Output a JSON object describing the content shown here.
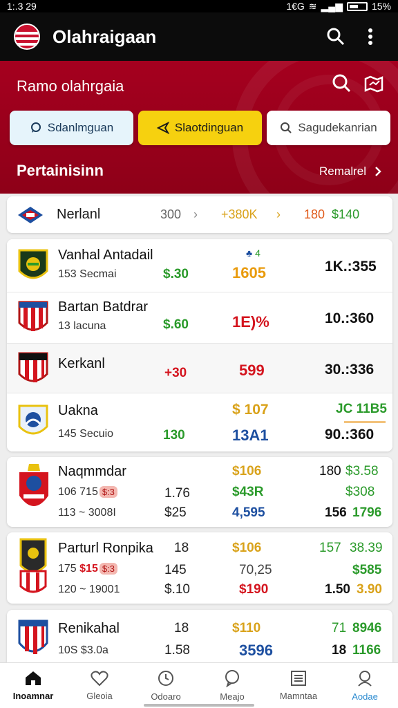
{
  "status": {
    "time": "1:.3 29",
    "right_text": "1€G",
    "battery": "15%"
  },
  "app": {
    "title": "Olahraigaan"
  },
  "hero": {
    "subtitle": "Ramo olahrgaia",
    "filters": [
      {
        "label": "Sdanlmguan",
        "icon": "chat-icon"
      },
      {
        "label": "Slaotdinguan",
        "icon": "send-icon"
      },
      {
        "label": "Sagudekanrian",
        "icon": "search-icon"
      }
    ],
    "section_title": "Pertainisinn",
    "section_more": "Remalrel"
  },
  "summary": {
    "name": "Nerlanl",
    "count": "300",
    "mid": "+380K",
    "right1": "180",
    "right2": "$140"
  },
  "rows": [
    {
      "name": "Vanhal Antadail",
      "sub": "153 Secmai",
      "a": "$.30",
      "b": "1605",
      "b_extra": "4",
      "c": "1K.:355"
    },
    {
      "name": "Bartan Batdrar",
      "sub": "13 lacuna",
      "a": "$.60",
      "b": "1E)%",
      "c": "10.:360"
    },
    {
      "name": "Kerkanl",
      "sub": "",
      "a": "+30",
      "b": "599",
      "c": "30.:336"
    },
    {
      "name": "Uakna",
      "sub": "145 Secuio",
      "a": "130",
      "top_b": "$ 107",
      "top_c": "JC 11B5",
      "b": "13A1",
      "c": "90.:360"
    }
  ],
  "details": [
    {
      "name": "Naqmmdar",
      "l1_a": "106 715",
      "l1_pill": "$:3",
      "l1_b": "1.76",
      "l1_c": "$106",
      "l1_d": "180",
      "l1_e": "$3.58",
      "l2_c": "$43R",
      "l2_e": "$308",
      "l3_a": "113 ~ 3008I",
      "l3_b": "$25",
      "l3_c": "4,595",
      "l3_d": "156",
      "l3_e": "1796"
    },
    {
      "name": "Parturl Ronpika",
      "name_extra": "18",
      "l1_a": "175",
      "l1_red": "$15",
      "l1_pill": "$:3",
      "l1_b": "145",
      "l1_c": "$106",
      "l1_d": "157",
      "l1_e": "38.39",
      "l2_c": "70,25",
      "l2_e": "$585",
      "l3_a": "120 ~ 19001",
      "l3_b": "$.10",
      "l3_c": "$190",
      "l3_d": "1.50",
      "l3_e": "3.90"
    },
    {
      "name": "Renikahal",
      "name_extra": "18",
      "l1_c": "$110",
      "l1_d": "71",
      "l1_e": "8946",
      "l3_a": "10S $3.0a",
      "l3_b": "1.58",
      "l3_c": "3596",
      "l3_d": "18",
      "l3_e": "1166"
    }
  ],
  "nav": [
    {
      "label": "Inoamnar",
      "icon": "home-icon"
    },
    {
      "label": "Gleoia",
      "icon": "heart-icon"
    },
    {
      "label": "Odoaro",
      "icon": "clock-icon"
    },
    {
      "label": "Meajo",
      "icon": "chat-icon"
    },
    {
      "label": "Mamntaa",
      "icon": "list-icon"
    },
    {
      "label": "Aodae",
      "icon": "user-icon"
    }
  ],
  "colors": {
    "brand_red": "#a5001f",
    "accent_yellow": "#f6d10f",
    "green": "#2a9a2a",
    "blue": "#1d4fa0"
  }
}
